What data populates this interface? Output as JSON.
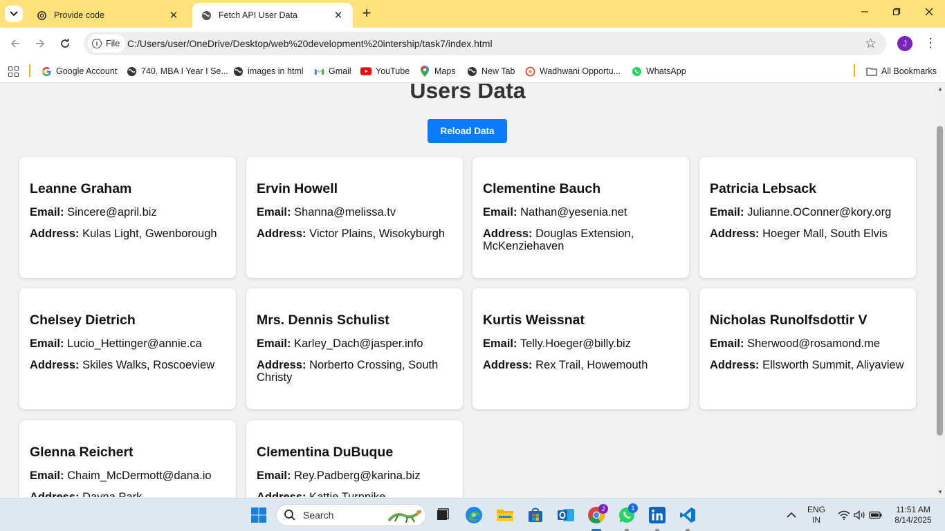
{
  "browser": {
    "tabs": [
      {
        "title": "Provide code"
      },
      {
        "title": "Fetch API User Data"
      }
    ],
    "address": {
      "scheme_label": "File",
      "url": "C:/Users/user/OneDrive/Desktop/web%20development%20intership/task7/index.html"
    },
    "profile_initial": "J",
    "bookmarks": [
      {
        "label": "Google Account",
        "icon": "google-icon"
      },
      {
        "label": "740. MBA I Year I Se...",
        "icon": "globe-icon"
      },
      {
        "label": "images in html",
        "icon": "globe-icon"
      },
      {
        "label": "Gmail",
        "icon": "gmail-icon"
      },
      {
        "label": "YouTube",
        "icon": "youtube-icon"
      },
      {
        "label": "Maps",
        "icon": "maps-icon"
      },
      {
        "label": "New Tab",
        "icon": "globe-icon"
      },
      {
        "label": "Wadhwani Opportu...",
        "icon": "wadhwani-icon"
      },
      {
        "label": "WhatsApp",
        "icon": "whatsapp-icon"
      }
    ],
    "all_bookmarks_label": "All Bookmarks"
  },
  "page": {
    "title": "Users Data",
    "reload_label": "Reload Data",
    "email_label": "Email:",
    "address_label": "Address:",
    "users": [
      {
        "name": "Leanne Graham",
        "email": "Sincere@april.biz",
        "address": "Kulas Light, Gwenborough"
      },
      {
        "name": "Ervin Howell",
        "email": "Shanna@melissa.tv",
        "address": "Victor Plains, Wisokyburgh"
      },
      {
        "name": "Clementine Bauch",
        "email": "Nathan@yesenia.net",
        "address": "Douglas Extension, McKenziehaven"
      },
      {
        "name": "Patricia Lebsack",
        "email": "Julianne.OConner@kory.org",
        "address": "Hoeger Mall, South Elvis"
      },
      {
        "name": "Chelsey Dietrich",
        "email": "Lucio_Hettinger@annie.ca",
        "address": "Skiles Walks, Roscoeview"
      },
      {
        "name": "Mrs. Dennis Schulist",
        "email": "Karley_Dach@jasper.info",
        "address": "Norberto Crossing, South Christy"
      },
      {
        "name": "Kurtis Weissnat",
        "email": "Telly.Hoeger@billy.biz",
        "address": "Rex Trail, Howemouth"
      },
      {
        "name": "Nicholas Runolfsdottir V",
        "email": "Sherwood@rosamond.me",
        "address": "Ellsworth Summit, Aliyaview"
      },
      {
        "name": "Glenna Reichert",
        "email": "Chaim_McDermott@dana.io",
        "address": "Dayna Park, Bartholomebury"
      },
      {
        "name": "Clementina DuBuque",
        "email": "Rey.Padberg@karina.biz",
        "address": "Kattie Turnpike, Lebsackbury"
      }
    ]
  },
  "taskbar": {
    "search_placeholder": "Search",
    "chrome_badge": "J",
    "whatsapp_badge": "1",
    "lang_line1": "ENG",
    "lang_line2": "IN",
    "time": "11:51 AM",
    "date": "8/14/2025"
  },
  "colors": {
    "tab_strip": "#fde27a",
    "button": "#0a7bff",
    "page_bg": "#f2f2f2",
    "card_bg": "#ffffff"
  }
}
